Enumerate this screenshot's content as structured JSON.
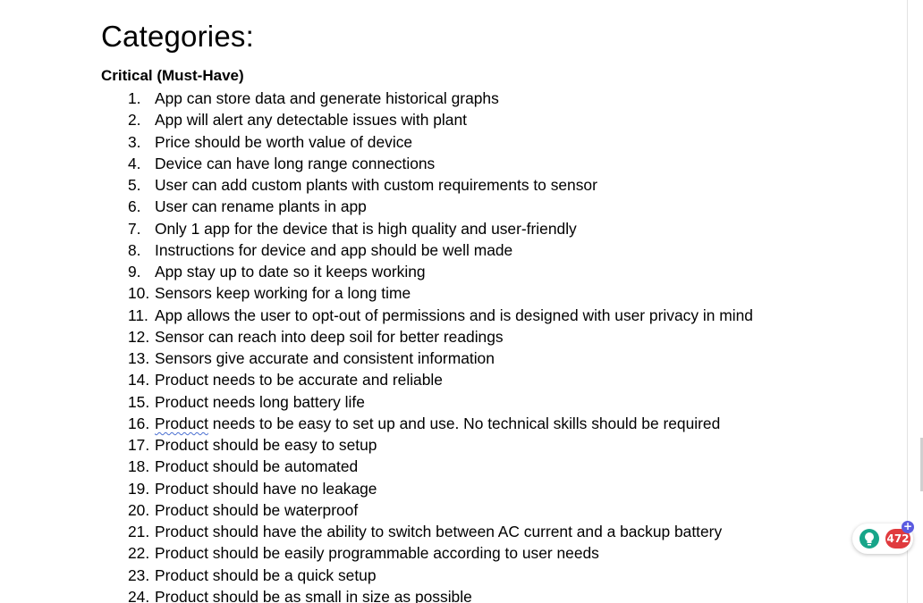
{
  "document": {
    "heading": "Categories:",
    "section_title": "Critical (Must-Have)",
    "items": [
      {
        "num": "1.",
        "text": "App can store data and generate historical graphs"
      },
      {
        "num": "2.",
        "text": "App will alert any detectable issues with plant"
      },
      {
        "num": "3.",
        "text": "Price should be worth value of device"
      },
      {
        "num": "4.",
        "text": "Device can have long range connections"
      },
      {
        "num": "5.",
        "text": "User can add custom plants with custom requirements to sensor"
      },
      {
        "num": "6.",
        "text": "User can rename plants in app"
      },
      {
        "num": "7.",
        "text": "Only 1 app for the device that is high quality and user-friendly"
      },
      {
        "num": "8.",
        "text": "Instructions for device and app should be well made"
      },
      {
        "num": "9.",
        "text": "App stay up to date so it keeps working"
      },
      {
        "num": "10.",
        "text": "Sensors keep working for a long time"
      },
      {
        "num": "11.",
        "text": "App allows the user to opt-out of permissions and is designed with user privacy in mind"
      },
      {
        "num": "12.",
        "text": "Sensor can reach into deep soil for better readings"
      },
      {
        "num": "13.",
        "text": "Sensors give accurate and consistent information"
      },
      {
        "num": "14.",
        "text": "Product needs to be accurate and reliable"
      },
      {
        "num": "15.",
        "text": "Product needs long battery life"
      },
      {
        "num": "16.",
        "text_first": "Product",
        "text_rest": " needs to be easy to set up and use. No technical skills should be required"
      },
      {
        "num": "17.",
        "text": "Product should be easy to setup"
      },
      {
        "num": "18.",
        "text": "Product should be automated"
      },
      {
        "num": "19.",
        "text": "Product should have no leakage"
      },
      {
        "num": "20.",
        "text": "Product should be waterproof"
      },
      {
        "num": "21.",
        "text": "Product should have the ability to switch between AC current and a backup battery"
      },
      {
        "num": "22.",
        "text": "Product should be easily programmable according to user needs"
      },
      {
        "num": "23.",
        "text": "Product should be a quick setup"
      },
      {
        "num": "24.",
        "text": "Product should be as small in size as possible"
      }
    ]
  },
  "widget": {
    "icon": "lightbulb-icon",
    "badge_count": "472",
    "plus_label": "+",
    "badge_color": "#e03a3e",
    "accent_color": "#5b5be0",
    "bulb_color": "#17a589"
  },
  "colors": {
    "spellcheck_underline": "#4a6fd1"
  }
}
